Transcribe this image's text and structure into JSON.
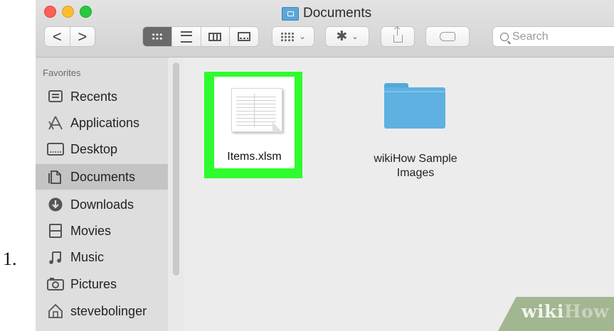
{
  "list_marker": "1.",
  "window": {
    "title": "Documents",
    "toolbar": {
      "back": "<",
      "forward": ">",
      "search_placeholder": "Search"
    }
  },
  "sidebar": {
    "heading": "Favorites",
    "items": [
      {
        "label": "Recents",
        "icon": "recents-icon",
        "selected": false
      },
      {
        "label": "Applications",
        "icon": "applications-icon",
        "selected": false
      },
      {
        "label": "Desktop",
        "icon": "desktop-icon",
        "selected": false
      },
      {
        "label": "Documents",
        "icon": "documents-icon",
        "selected": true
      },
      {
        "label": "Downloads",
        "icon": "downloads-icon",
        "selected": false
      },
      {
        "label": "Movies",
        "icon": "movies-icon",
        "selected": false
      },
      {
        "label": "Music",
        "icon": "music-icon",
        "selected": false
      },
      {
        "label": "Pictures",
        "icon": "pictures-icon",
        "selected": false
      },
      {
        "label": "stevebolinger",
        "icon": "home-icon",
        "selected": false
      }
    ]
  },
  "files": [
    {
      "name": "Items.xlsm",
      "type": "spreadsheet",
      "highlighted": true
    },
    {
      "name_line1": "wikiHow Sample",
      "name_line2": "Images",
      "type": "folder"
    }
  ],
  "watermark": {
    "part1": "wiki",
    "part2": "How"
  },
  "colors": {
    "highlight": "#2dfc2d",
    "folder": "#5eb1e1",
    "selected_row": "#c4c4c4"
  }
}
